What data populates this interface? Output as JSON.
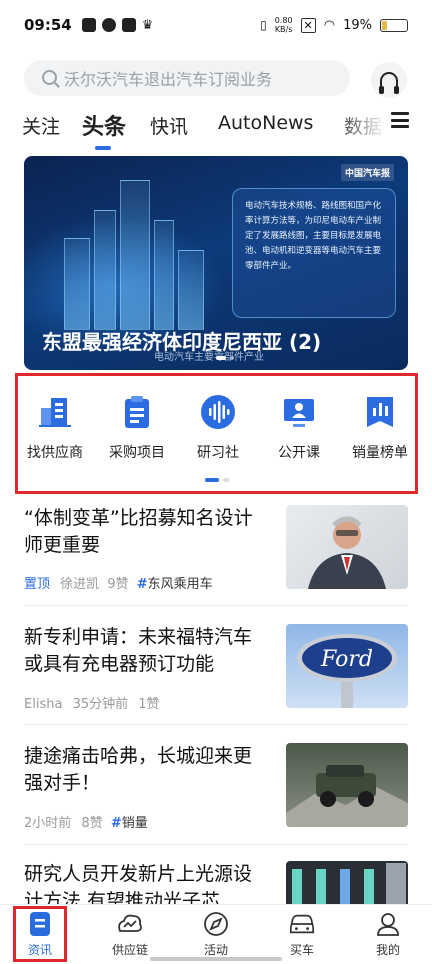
{
  "status_bar": {
    "time": "09:54",
    "net_speed": "0.80",
    "net_unit": "KB/s",
    "battery": "19%",
    "battery_level": 0.19
  },
  "search": {
    "placeholder": "沃尔沃汽车退出汽车订阅业务"
  },
  "tabs": [
    "关注",
    "头条",
    "快讯",
    "AutoNews",
    "数据"
  ],
  "active_tab": "头条",
  "banner": {
    "title": "东盟最强经济体印度尼西亚 (2)",
    "subtitle": "电动汽车主要零部件产业",
    "logo_text": "中国汽车报",
    "card_text": "电动汽车技术规格、路线图和国产化率计算方法等，为印尼电动车产业制定了发展路线图，主要目标是发展电池、电动机和逆变器等电动汽车主要零部件产业。"
  },
  "quick_entries": [
    {
      "label": "找供应商",
      "icon": "building-icon"
    },
    {
      "label": "采购项目",
      "icon": "clipboard-icon"
    },
    {
      "label": "研习社",
      "icon": "voice-wave-icon"
    },
    {
      "label": "公开课",
      "icon": "presenter-icon"
    },
    {
      "label": "销量榜单",
      "icon": "bar-chart-icon"
    }
  ],
  "news": [
    {
      "title": "“体制变革”比招募知名设计师更重要",
      "pin": "置顶",
      "author": "徐进凯",
      "likes": "9赞",
      "tag": "东风乘用车",
      "time": ""
    },
    {
      "title": "新专利申请：未来福特汽车或具有充电器预订功能",
      "pin": "",
      "author": "Elisha",
      "time": "35分钟前",
      "likes": "1赞",
      "tag": ""
    },
    {
      "title": "捷途痛击哈弗，长城迎来更强对手！",
      "pin": "",
      "author": "",
      "time": "2小时前",
      "likes": "8赞",
      "tag": "销量"
    },
    {
      "title": "研究人员开发新片上光源设计方法 有望推动光子芯",
      "pin": "",
      "author": "",
      "time": "",
      "likes": "",
      "tag": ""
    }
  ],
  "bottom_nav": [
    {
      "label": "资讯",
      "icon": "news-icon"
    },
    {
      "label": "供应链",
      "icon": "supply-chain-icon"
    },
    {
      "label": "活动",
      "icon": "compass-icon"
    },
    {
      "label": "买车",
      "icon": "car-icon"
    },
    {
      "label": "我的",
      "icon": "user-icon"
    }
  ],
  "active_nav": "资讯",
  "colors": {
    "accent": "#2b6de0",
    "highlight": "#e0272c"
  }
}
